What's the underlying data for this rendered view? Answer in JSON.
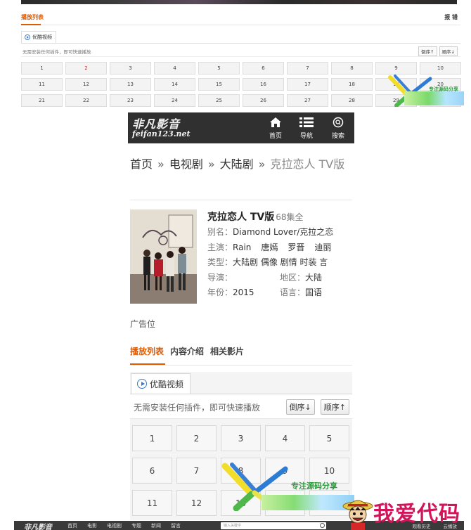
{
  "top_strip": {
    "playlist_tab": "播放列表",
    "report_label": "报 错",
    "source_tab": "优酷视频",
    "hint": "无需安装任何插件，即可快速播放",
    "sort_desc": "倒序↑",
    "sort_asc": "顺序↓",
    "episodes": [
      "1",
      "2",
      "3",
      "4",
      "5",
      "6",
      "7",
      "8",
      "9",
      "10",
      "11",
      "12",
      "13",
      "14",
      "15",
      "16",
      "17",
      "18",
      "19",
      "20",
      "21",
      "22",
      "23",
      "24",
      "25",
      "26",
      "27",
      "28",
      "29",
      "30"
    ],
    "active_episode": "2"
  },
  "header": {
    "logo_cn": "非凡影音",
    "logo_en": "feifan123.net",
    "nav": [
      {
        "label": "首页",
        "icon": "home-icon"
      },
      {
        "label": "导航",
        "icon": "list-icon"
      },
      {
        "label": "搜索",
        "icon": "search-icon"
      }
    ]
  },
  "breadcrumb": {
    "home": "首页",
    "sep": "»",
    "category": "电视剧",
    "subcategory": "大陆剧",
    "current": "克拉恋人 TV版"
  },
  "detail": {
    "title": "克拉恋人 TV版",
    "episode_count": "68集全",
    "alias_key": "别名：",
    "alias": "Diamond Lover/克拉之恋",
    "cast_key": "主演：",
    "cast": [
      "Rain",
      "唐嫣",
      "罗晋",
      "迪丽"
    ],
    "genre_key": "类型：",
    "genres": "大陆剧 偶像 剧情 时装 言",
    "director_key": "导演：",
    "director": "",
    "region_key": "地区：",
    "region": "大陆",
    "year_key": "年份：",
    "year": "2015",
    "language_key": "语言：",
    "language": "国语",
    "poster_icon": "poster-image"
  },
  "ad": "广告位",
  "tabs": [
    "播放列表",
    "内容介绍",
    "相关影片"
  ],
  "playlist": {
    "source_tab": "优酷视频",
    "hint": "无需安装任何插件，即可快速播放",
    "sort_desc": "倒序↓",
    "sort_asc": "顺序↑",
    "episodes": [
      "1",
      "2",
      "3",
      "4",
      "5",
      "6",
      "7",
      "8",
      "9",
      "10",
      "11",
      "12",
      "13",
      "14",
      "15"
    ]
  },
  "watermark": {
    "text": "专注源码分享",
    "icon": "watermark-logo"
  },
  "footer": {
    "logo": "非凡影音",
    "menu": [
      "首页",
      "电影",
      "电视剧",
      "专题",
      "新闻",
      "留言"
    ],
    "search_placeholder": "输入关键字",
    "right_items": [
      "观看历史",
      "云播放"
    ]
  },
  "stamp": {
    "text": "我爱代码",
    "icon": "onepiece-avatar-icon"
  },
  "colors": {
    "accent_orange": "#e05a00",
    "header_bg": "#303030",
    "active_red": "#e02020",
    "stamp_pink": "#d4145a"
  }
}
